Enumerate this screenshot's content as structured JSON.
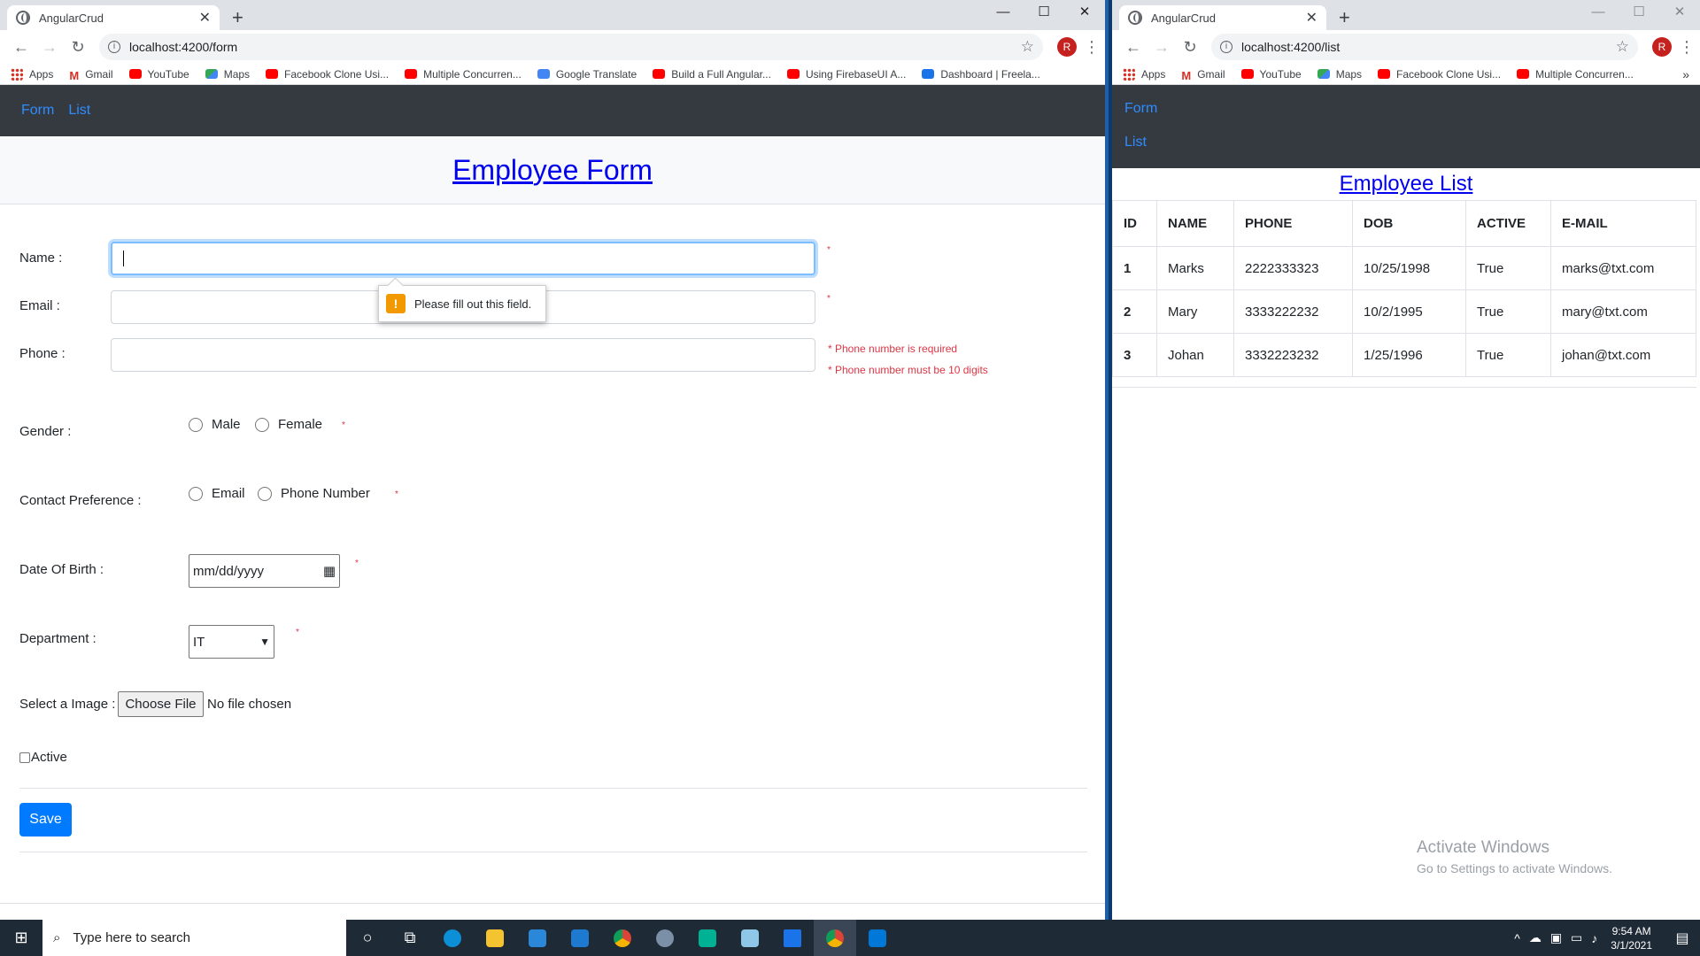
{
  "left_window": {
    "tab_title": "AngularCrud",
    "url": "localhost:4200/form",
    "avatar_letter": "R",
    "bookmarks": [
      "Apps",
      "Gmail",
      "YouTube",
      "Maps",
      "Facebook Clone Usi...",
      "Multiple Concurren...",
      "Google Translate",
      "Build a Full Angular...",
      "Using FirebaseUI A...",
      "Dashboard | Freela..."
    ],
    "nav": {
      "form": "Form",
      "list": "List"
    },
    "page_title": "Employee Form",
    "form": {
      "name_label": "Name :",
      "email_label": "Email :",
      "phone_label": "Phone :",
      "gender_label": "Gender :",
      "gender_male": "Male",
      "gender_female": "Female",
      "contact_label": "Contact Preference :",
      "contact_email": "Email",
      "contact_phone": "Phone Number",
      "dob_label": "Date Of Birth :",
      "dob_placeholder": "mm/dd/yyyy",
      "department_label": "Department :",
      "department_value": "IT",
      "image_label": "Select a Image :",
      "choose_file": "Choose File",
      "no_file": "No file chosen",
      "active_label": "Active",
      "save": "Save",
      "required_mark": "*",
      "phone_error_required": "* Phone number is required",
      "phone_error_digits": "* Phone number must be 10 digits",
      "tooltip": "Please fill out this field."
    }
  },
  "right_window": {
    "tab_title": "AngularCrud",
    "url": "localhost:4200/list",
    "avatar_letter": "R",
    "bookmarks": [
      "Apps",
      "Gmail",
      "YouTube",
      "Maps",
      "Facebook Clone Usi...",
      "Multiple Concurren..."
    ],
    "nav": {
      "form": "Form",
      "list": "List"
    },
    "page_title": "Employee List",
    "table": {
      "headers": [
        "ID",
        "NAME",
        "PHONE",
        "DOB",
        "ACTIVE",
        "E-MAIL"
      ],
      "rows": [
        [
          "1",
          "Marks",
          "2222333323",
          "10/25/1998",
          "True",
          "marks@txt.com"
        ],
        [
          "2",
          "Mary",
          "3333222232",
          "10/2/1995",
          "True",
          "mary@txt.com"
        ],
        [
          "3",
          "Johan",
          "3332223232",
          "1/25/1996",
          "True",
          "johan@txt.com"
        ]
      ]
    },
    "activate_title": "Activate Windows",
    "activate_sub": "Go to Settings to activate Windows."
  },
  "taskbar": {
    "search_placeholder": "Type here to search",
    "time": "9:54 AM",
    "date": "3/1/2021"
  }
}
